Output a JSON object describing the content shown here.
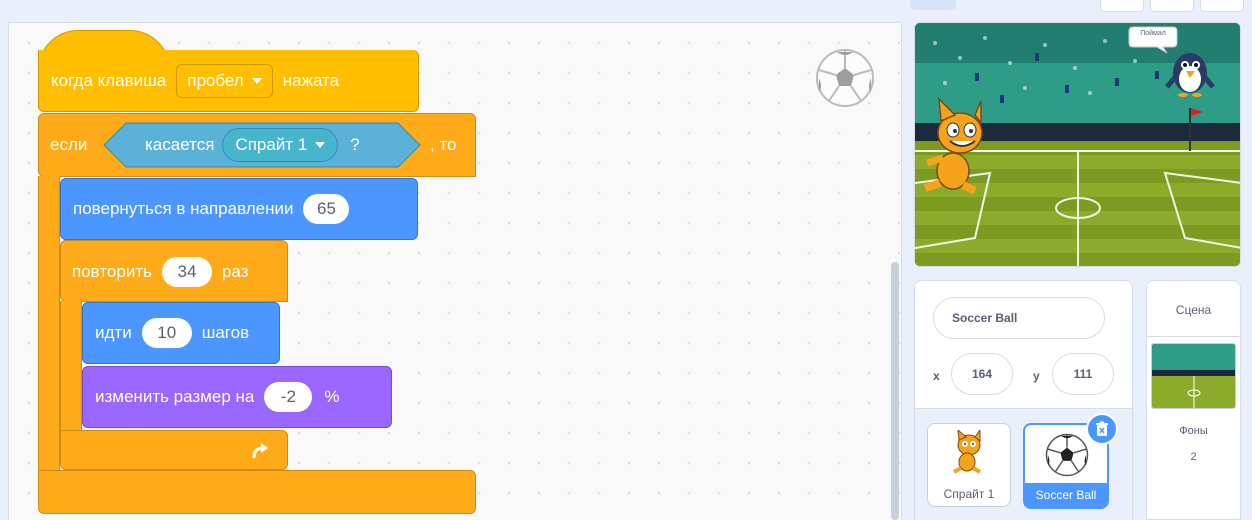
{
  "blocks": {
    "hat": {
      "text1": "когда клавиша",
      "key": "пробел",
      "text2": "нажата"
    },
    "if": {
      "text1": "если",
      "text2": ", то"
    },
    "sensing": {
      "text": "касается",
      "target": "Спрайт 1",
      "question": "?"
    },
    "point": {
      "text": "повернуться в направлении",
      "value": "65"
    },
    "repeat": {
      "text1": "повторить",
      "value": "34",
      "text2": "раз"
    },
    "move": {
      "text1": "идти",
      "value": "10",
      "text2": "шагов"
    },
    "size": {
      "text1": "изменить размер на",
      "value": "-2",
      "text2": "%"
    }
  },
  "stage": {
    "speech": "Поймал"
  },
  "sprite_info": {
    "name": "Soccer Ball",
    "x_label": "x",
    "x_value": "164",
    "y_label": "y",
    "y_value": "111"
  },
  "sprites": [
    {
      "name": "Спрайт 1"
    },
    {
      "name": "Soccer Ball"
    }
  ],
  "stage_panel": {
    "title": "Сцена",
    "backdrops_label": "Фоны",
    "backdrops_count": "2"
  },
  "colors": {
    "events": "#ffbf00",
    "control": "#ffab19",
    "motion": "#4c97ff",
    "looks": "#9966ff",
    "sensing": "#5cb1d6"
  }
}
